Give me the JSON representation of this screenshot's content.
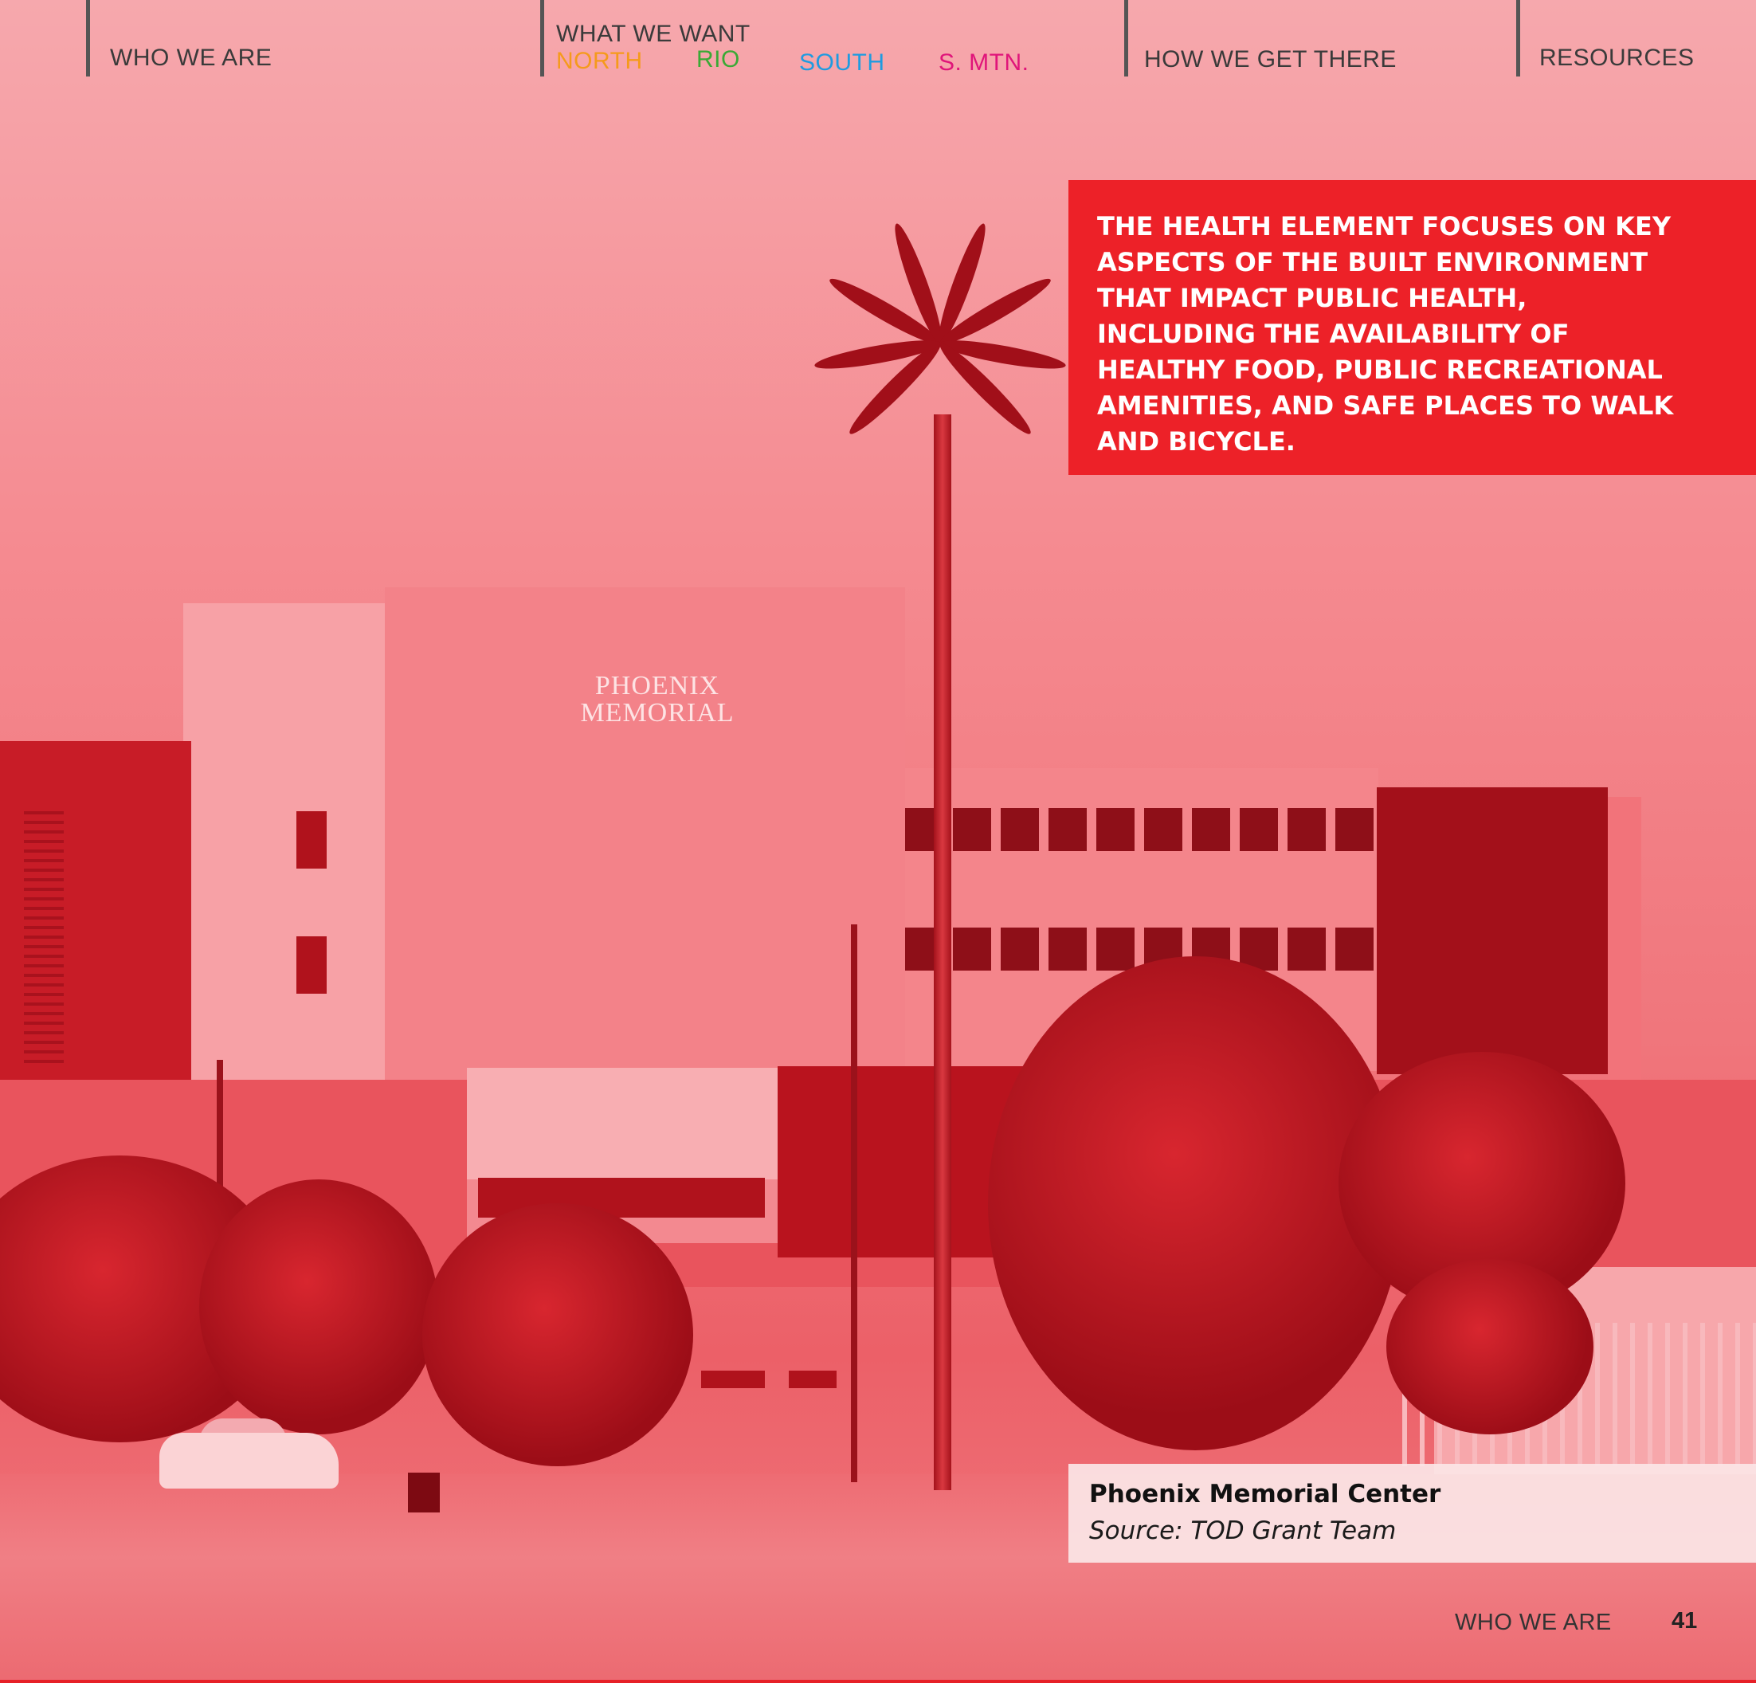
{
  "nav": {
    "who_we_are": "WHO WE ARE",
    "what_we_want": "WHAT WE WANT",
    "sub_north": "NORTH",
    "sub_rio": "RIO",
    "sub_south": "SOUTH",
    "sub_smtn": "S. MTN.",
    "how_we_get_there": "HOW WE GET THERE",
    "resources": "RESOURCES",
    "colors": {
      "north": "#f59a1b",
      "rio": "#3aa935",
      "south": "#1f9be0",
      "smtn": "#e0157a"
    }
  },
  "photo": {
    "sign_line1": "PHOENIX",
    "sign_line2": "MEMORIAL"
  },
  "callout": {
    "text": "THE HEALTH ELEMENT FOCUSES ON KEY\nASPECTS OF THE BUILT ENVIRONMENT\nTHAT IMPACT PUBLIC HEALTH,\nINCLUDING THE AVAILABILITY OF\nHEALTHY FOOD, PUBLIC RECREATIONAL\nAMENITIES, AND SAFE PLACES TO WALK\nAND BICYCLE.",
    "color": "#ed2128"
  },
  "caption": {
    "title": "Phoenix Memorial Center",
    "source": "Source: TOD Grant Team"
  },
  "footer": {
    "section": "WHO WE ARE",
    "page": "41"
  }
}
